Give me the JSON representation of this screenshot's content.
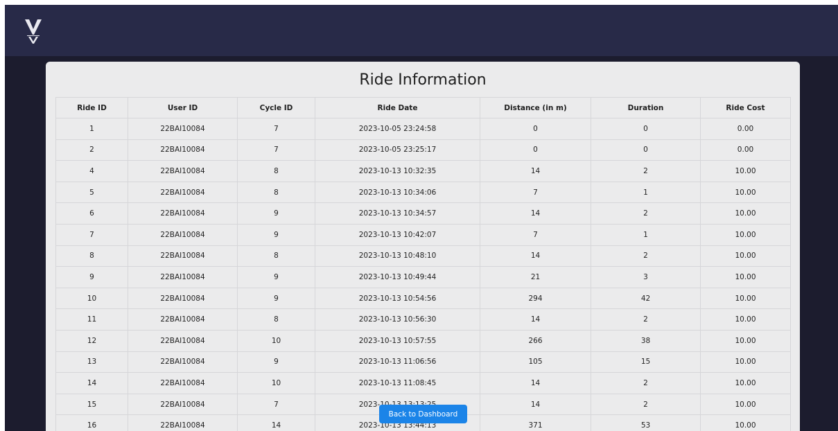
{
  "app": {
    "logo_icon": "v-monogram-logo-icon",
    "colors": {
      "topbar": "#282a48",
      "background": "#1c1c2e",
      "card": "#ebebec",
      "button": "#1b84e8"
    }
  },
  "card": {
    "title": "Ride Information"
  },
  "table": {
    "headers": [
      "Ride ID",
      "User ID",
      "Cycle ID",
      "Ride Date",
      "Distance (in m)",
      "Duration",
      "Ride Cost"
    ],
    "rows": [
      [
        "1",
        "22BAI10084",
        "7",
        "2023-10-05 23:24:58",
        "0",
        "0",
        "0.00"
      ],
      [
        "2",
        "22BAI10084",
        "7",
        "2023-10-05 23:25:17",
        "0",
        "0",
        "0.00"
      ],
      [
        "4",
        "22BAI10084",
        "8",
        "2023-10-13 10:32:35",
        "14",
        "2",
        "10.00"
      ],
      [
        "5",
        "22BAI10084",
        "8",
        "2023-10-13 10:34:06",
        "7",
        "1",
        "10.00"
      ],
      [
        "6",
        "22BAI10084",
        "9",
        "2023-10-13 10:34:57",
        "14",
        "2",
        "10.00"
      ],
      [
        "7",
        "22BAI10084",
        "9",
        "2023-10-13 10:42:07",
        "7",
        "1",
        "10.00"
      ],
      [
        "8",
        "22BAI10084",
        "8",
        "2023-10-13 10:48:10",
        "14",
        "2",
        "10.00"
      ],
      [
        "9",
        "22BAI10084",
        "9",
        "2023-10-13 10:49:44",
        "21",
        "3",
        "10.00"
      ],
      [
        "10",
        "22BAI10084",
        "9",
        "2023-10-13 10:54:56",
        "294",
        "42",
        "10.00"
      ],
      [
        "11",
        "22BAI10084",
        "8",
        "2023-10-13 10:56:30",
        "14",
        "2",
        "10.00"
      ],
      [
        "12",
        "22BAI10084",
        "10",
        "2023-10-13 10:57:55",
        "266",
        "38",
        "10.00"
      ],
      [
        "13",
        "22BAI10084",
        "9",
        "2023-10-13 11:06:56",
        "105",
        "15",
        "10.00"
      ],
      [
        "14",
        "22BAI10084",
        "10",
        "2023-10-13 11:08:45",
        "14",
        "2",
        "10.00"
      ],
      [
        "15",
        "22BAI10084",
        "7",
        "2023-10-13 13:13:25",
        "14",
        "2",
        "10.00"
      ],
      [
        "16",
        "22BAI10084",
        "14",
        "2023-10-13 13:44:13",
        "371",
        "53",
        "10.00"
      ]
    ]
  },
  "actions": {
    "back_label": "Back to Dashboard"
  }
}
